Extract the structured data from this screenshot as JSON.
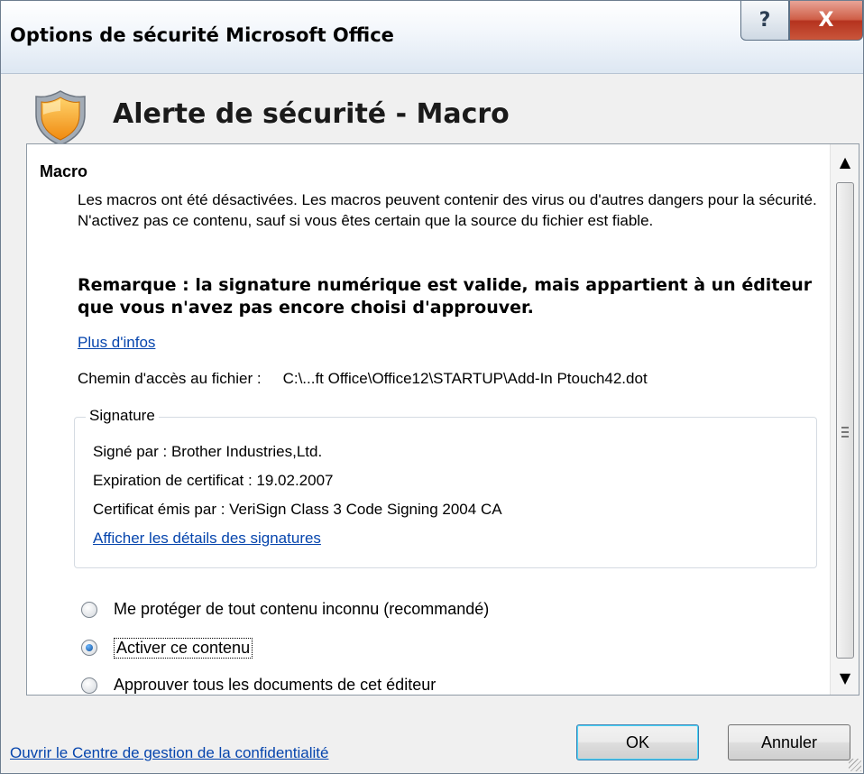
{
  "window": {
    "title": "Options de sécurité Microsoft Office",
    "help_label": "?",
    "close_label": "X"
  },
  "header": {
    "title": "Alerte de sécurité - Macro",
    "icon": "security-shield-icon",
    "icon_colors": {
      "rim": "#9aa3ad",
      "fill": "#f5a623",
      "highlight": "#ffd36b"
    }
  },
  "content": {
    "section_heading": "Macro",
    "description": "Les macros ont été désactivées. Les macros peuvent contenir des virus ou d'autres dangers pour la sécurité. N'activez pas ce contenu, sauf si vous êtes certain que la source du fichier est fiable.",
    "remark": "Remarque : la signature numérique est valide, mais appartient à un éditeur que vous n'avez pas encore choisi d'approuver.",
    "more_info_link": "Plus d'infos",
    "file_path_label": "Chemin d'accès au fichier :",
    "file_path_value": "C:\\...ft Office\\Office12\\STARTUP\\Add-In Ptouch42.dot",
    "signature": {
      "legend": "Signature",
      "signed_by": "Signé par : Brother Industries,Ltd.",
      "expiration": "Expiration de certificat : 19.02.2007",
      "issuer": "Certificat émis par : VeriSign Class 3 Code Signing 2004 CA",
      "details_link": "Afficher les détails des signatures"
    },
    "options": [
      {
        "label": "Me protéger de tout contenu inconnu (recommandé)",
        "selected": false
      },
      {
        "label": "Activer ce contenu",
        "selected": true
      },
      {
        "label": "Approuver tous les documents de cet éditeur",
        "selected": false
      }
    ]
  },
  "scrollbar": {
    "up_icon": "▲",
    "down_icon": "▼"
  },
  "footer": {
    "trust_center_link": "Ouvrir le Centre de gestion de la confidentialité",
    "ok_label": "OK",
    "cancel_label": "Annuler"
  },
  "colors": {
    "link": "#0645ad",
    "close_button": "#c9563b"
  }
}
